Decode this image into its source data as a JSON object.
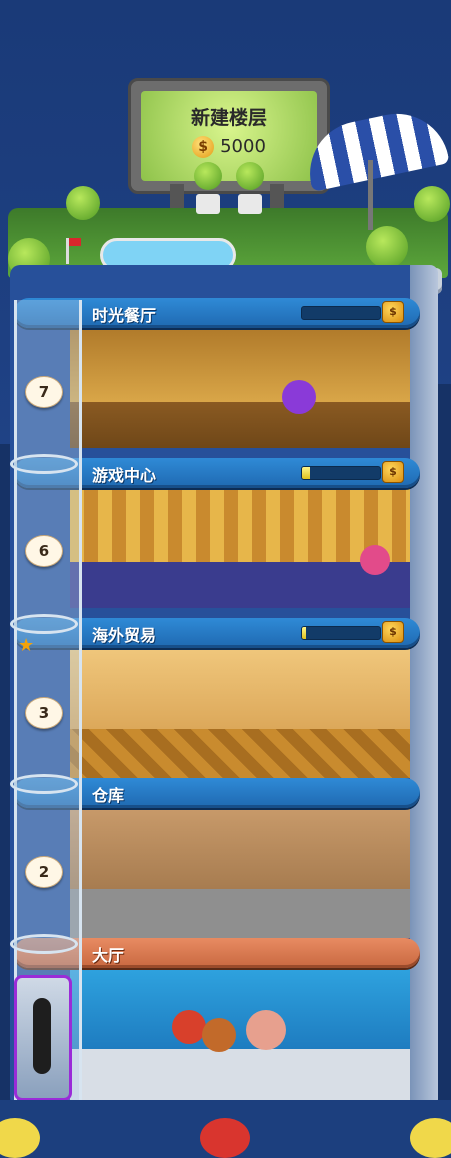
{
  "billboard": {
    "title": "新建楼层",
    "price": "5000",
    "coin_symbol": "$"
  },
  "floors": [
    {
      "name": "时光餐厅",
      "number": "7",
      "progress": 0.0,
      "color": "#2f8ad6"
    },
    {
      "name": "游戏中心",
      "number": "6",
      "progress": 0.1,
      "color": "#2f8ad6"
    },
    {
      "name": "海外贸易",
      "number": "3",
      "progress": 0.05,
      "color": "#2f8ad6"
    },
    {
      "name": "仓库",
      "number": "2",
      "color": "#2f8ad6"
    },
    {
      "name": "大厅",
      "color": "#e88b62"
    }
  ],
  "coin_button_symbol": "$",
  "icons": {
    "coin": "coin-icon",
    "star": "star-icon",
    "elevator": "elevator-icon"
  },
  "colors": {
    "sky": "#1c3f7e",
    "bar_blue": "#2f8ad6",
    "bar_lobby": "#e88b62",
    "progress_fill": "#e0c21c"
  }
}
